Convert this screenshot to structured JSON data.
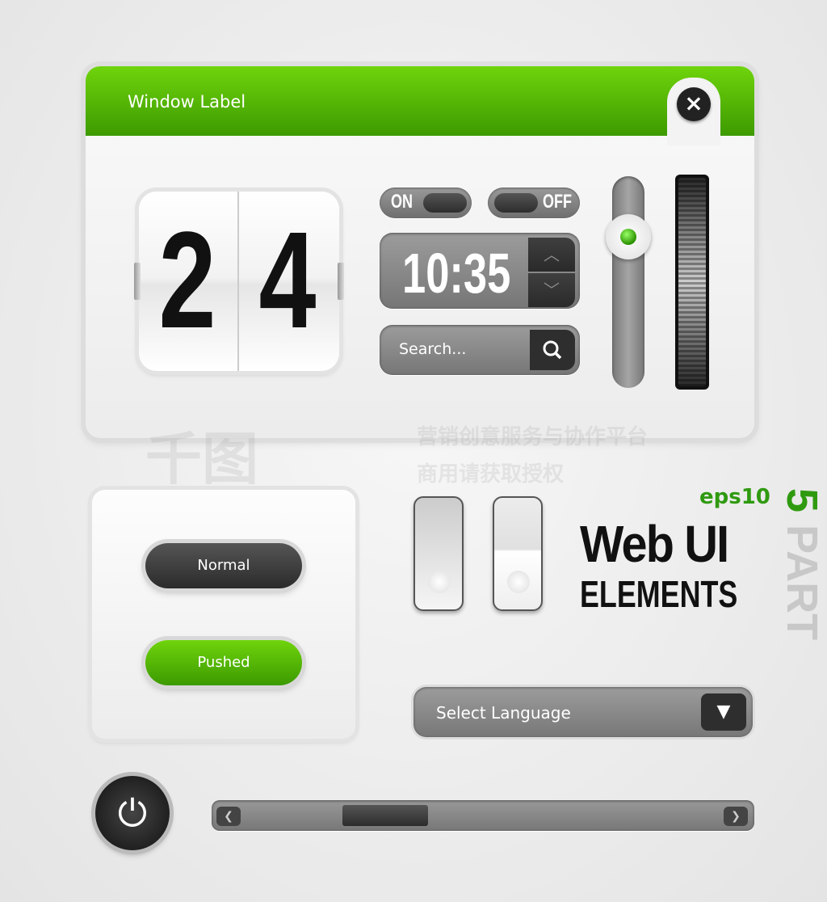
{
  "window": {
    "title": "Window Label",
    "close_icon": "close-icon"
  },
  "flip_clock": {
    "digits": [
      "2",
      "4"
    ]
  },
  "toggles": {
    "on_label": "ON",
    "off_label": "OFF"
  },
  "time_picker": {
    "value": "10:35",
    "up_icon": "chevron-up-icon",
    "down_icon": "chevron-down-icon"
  },
  "search": {
    "placeholder": "Search...",
    "icon": "search-icon"
  },
  "vertical_slider": {
    "level_percent": 60,
    "accent": "#3fae00"
  },
  "buttons": {
    "normal": "Normal",
    "pushed": "Pushed"
  },
  "branding": {
    "eps": "eps10",
    "title_line1": "Web UI",
    "title_line2": "ELEMENTS",
    "part_word": "PART",
    "part_number": "5"
  },
  "language_select": {
    "value": "Select Language",
    "icon": "caret-down-icon"
  },
  "power": {
    "icon": "power-icon"
  },
  "scrollbar": {
    "position_percent": 25
  },
  "watermark": {
    "logo": "千图",
    "line1": "营销创意服务与协作平台",
    "line2": "商用请获取授权"
  },
  "colors": {
    "accent_green": "#5cc40a",
    "dark": "#2e2e2e",
    "gray": "#8a8a8a"
  }
}
